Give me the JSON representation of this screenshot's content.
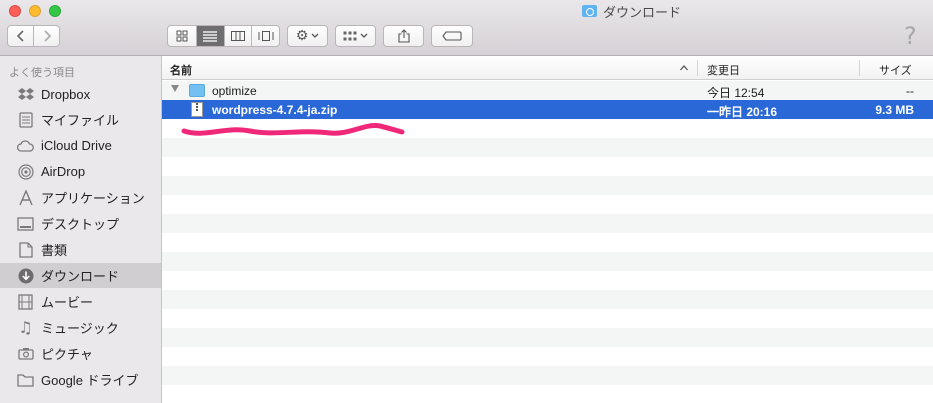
{
  "window": {
    "title": "ダウンロード",
    "title_icon": "downloads-folder-icon"
  },
  "toolbar": {
    "back_icon": "chevron-left-icon",
    "forward_icon": "chevron-right-icon",
    "views": [
      "icon-view",
      "list-view",
      "column-view",
      "coverflow-view"
    ],
    "active_view": "list-view",
    "help": "?"
  },
  "sidebar": {
    "header": "よく使う項目",
    "items": [
      {
        "label": "Dropbox",
        "icon": "dropbox-icon"
      },
      {
        "label": "マイファイル",
        "icon": "all-my-files-icon"
      },
      {
        "label": "iCloud Drive",
        "icon": "cloud-icon"
      },
      {
        "label": "AirDrop",
        "icon": "airdrop-icon"
      },
      {
        "label": "アプリケーション",
        "icon": "applications-icon"
      },
      {
        "label": "デスクトップ",
        "icon": "desktop-icon"
      },
      {
        "label": "書類",
        "icon": "documents-icon"
      },
      {
        "label": "ダウンロード",
        "icon": "download-icon",
        "selected": true
      },
      {
        "label": "ムービー",
        "icon": "movies-icon"
      },
      {
        "label": "ミュージック",
        "icon": "music-icon"
      },
      {
        "label": "ピクチャ",
        "icon": "camera-icon"
      },
      {
        "label": "Google ドライブ",
        "icon": "folder-icon"
      }
    ]
  },
  "columns": {
    "name": "名前",
    "date": "変更日",
    "size": "サイズ"
  },
  "files": [
    {
      "name": "optimize",
      "date": "今日 12:54",
      "size": "--",
      "kind": "folder",
      "expanded": true
    },
    {
      "name": "wordpress-4.7.4-ja.zip",
      "date": "一昨日 20:16",
      "size": "9.3 MB",
      "kind": "zip",
      "selected": true
    }
  ],
  "colors": {
    "selection": "#2a68d8",
    "annotation": "#f0287a"
  }
}
